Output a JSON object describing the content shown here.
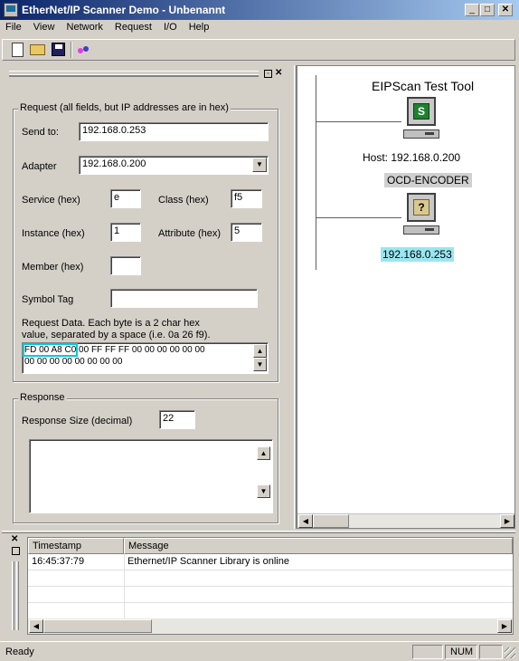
{
  "window": {
    "title": "EtherNet/IP Scanner Demo - Unbenannt"
  },
  "menu": [
    {
      "label": "File"
    },
    {
      "label": "View"
    },
    {
      "label": "Network"
    },
    {
      "label": "Request"
    },
    {
      "label": "I/O"
    },
    {
      "label": "Help"
    }
  ],
  "request": {
    "group_title": "Request (all fields, but IP addresses are in hex)",
    "send_to_label": "Send to:",
    "send_to_value": "192.168.0.253",
    "adapter_label": "Adapter",
    "adapter_value": "192.168.0.200",
    "service_label": "Service (hex)",
    "service_value": "e",
    "class_label": "Class (hex)",
    "class_value": "f5",
    "instance_label": "Instance (hex)",
    "instance_value": "1",
    "attribute_label": "Attribute (hex)",
    "attribute_value": "5",
    "member_label": "Member (hex)",
    "member_value": "",
    "symbol_label": "Symbol Tag",
    "symbol_value": "",
    "data_hint_line1": "Request Data. Each byte is a 2 char hex",
    "data_hint_line2": "value, separated by a space (i.e. 0a 26 f9).",
    "data_selected": "FD 00 A8 C0",
    "data_rest_line1": " 00 FF FF FF 00 00 00 00 00 00",
    "data_line2": "00 00 00 00 00 00 00 00"
  },
  "response": {
    "group_title": "Response",
    "size_label": "Response Size (decimal)",
    "size_value": "22",
    "data_value": ""
  },
  "network": {
    "tool_title": "EIPScan Test Tool",
    "host_letter": "S",
    "host_label": "Host: 192.168.0.200",
    "device_name": "OCD-ENCODER",
    "device_letter": "?",
    "device_ip": "192.168.0.253"
  },
  "log": {
    "columns": [
      "Timestamp",
      "Message"
    ],
    "rows": [
      {
        "timestamp": "16:45:37:79",
        "message": "Ethernet/IP Scanner Library is online"
      }
    ]
  },
  "status": {
    "text": "Ready",
    "num": "NUM"
  },
  "colors": {
    "selection_cyan": "#00c8e0",
    "device_ip_bg": "#9ae6f0",
    "title_gradient_start": "#0a246a",
    "title_gradient_end": "#a6caf0"
  }
}
